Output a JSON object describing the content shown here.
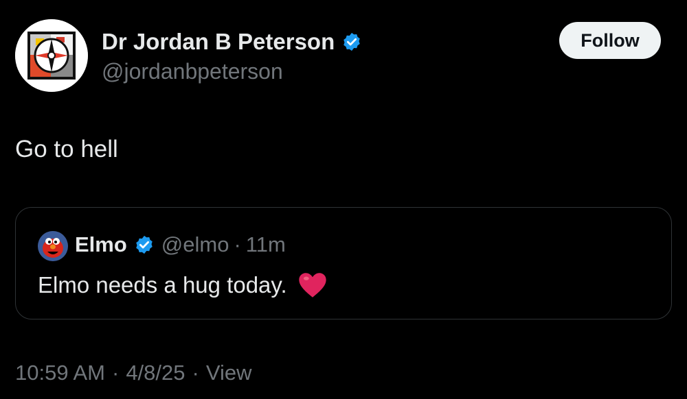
{
  "author": {
    "name": "Dr Jordan B Peterson",
    "handle": "@jordanbpeterson",
    "avatar_icon": "compass-logo-icon",
    "verified_icon": "verified-badge-icon"
  },
  "follow_button": {
    "label": "Follow"
  },
  "tweet": {
    "text": "Go to hell"
  },
  "quoted_tweet": {
    "name": "Elmo",
    "handle": "@elmo",
    "separator": "·",
    "time": "11m",
    "text": "Elmo needs a hug today.",
    "emoji_icon": "red-heart-icon",
    "avatar_icon": "elmo-avatar-icon"
  },
  "meta": {
    "time": "10:59 AM",
    "separator": "·",
    "date": "4/8/25",
    "views_label": "View"
  },
  "colors": {
    "background": "#000000",
    "text": "#e7e9ea",
    "muted": "#71767b",
    "verified": "#1d9bf0",
    "border": "#2f3336",
    "heart": "#e0245e"
  }
}
